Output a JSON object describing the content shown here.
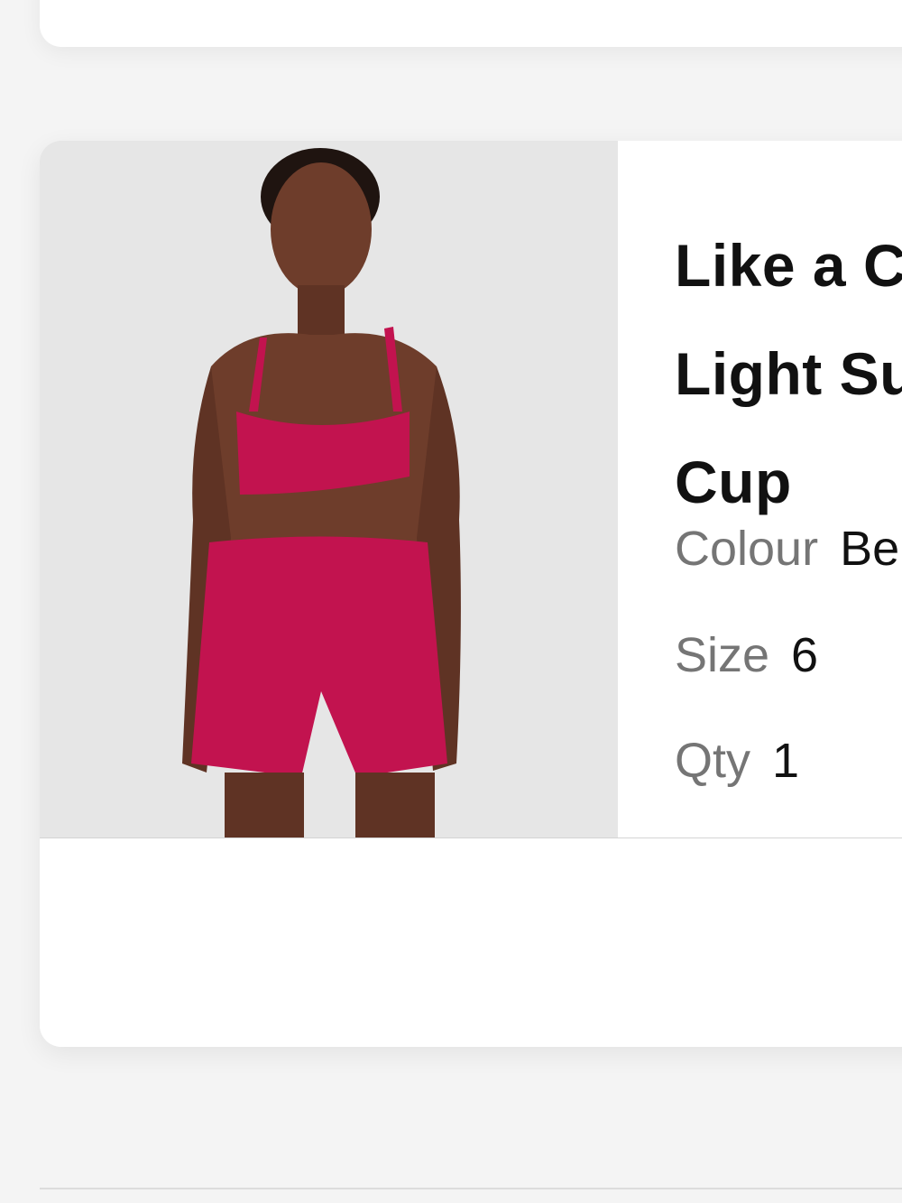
{
  "cart_item": {
    "title": "Like a Cloud Bra Light Support, B/C Cup",
    "image_alt": "Model wearing pink sports bra and shorts",
    "attributes": [
      {
        "label": "Colour",
        "value": "Berry"
      },
      {
        "label": "Size",
        "value": "6"
      },
      {
        "label": "Qty",
        "value": "1"
      }
    ]
  },
  "colors": {
    "garment": "#c2134f",
    "image_background": "#e6e6e6",
    "page_background": "#f4f4f4"
  }
}
